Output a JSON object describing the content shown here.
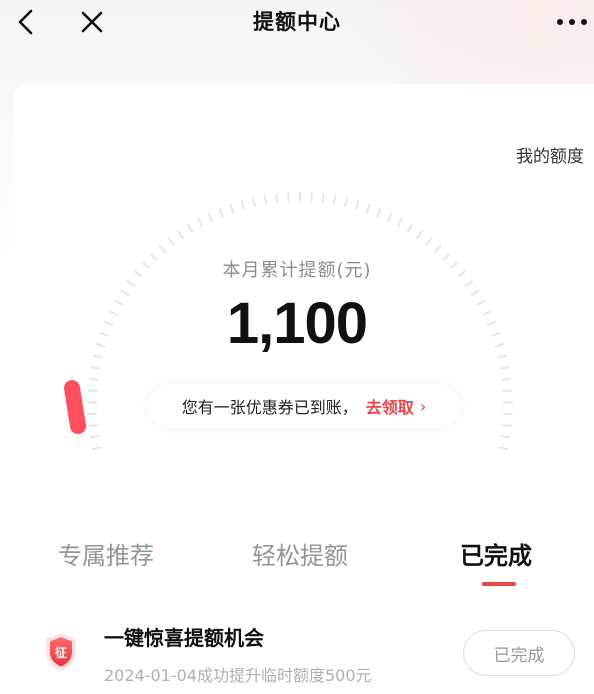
{
  "nav": {
    "title": "提额中心",
    "back_icon": "chevron-left-icon",
    "close_icon": "close-icon",
    "more_icon": "more-horizontal-icon"
  },
  "quota_link": "我的额度",
  "gauge": {
    "label": "本月累计提额(元)",
    "value": "1,100",
    "accent_color": "#ff4f5e"
  },
  "coupon": {
    "text": "您有一张优惠券已到账，",
    "link": "去领取",
    "chevron": "›"
  },
  "tabs": [
    {
      "label": "专属推荐",
      "active": false
    },
    {
      "label": "轻松提额",
      "active": false
    },
    {
      "label": "已完成",
      "active": true
    }
  ],
  "items": [
    {
      "badge_text": "征",
      "title": "一键惊喜提额机会",
      "description": "2024-01-04成功提升临时额度500元",
      "button": "已完成"
    }
  ],
  "colors": {
    "accent": "#e8454a",
    "tab_inactive": "#8e9a8e",
    "muted_text": "#b0b0b0"
  }
}
